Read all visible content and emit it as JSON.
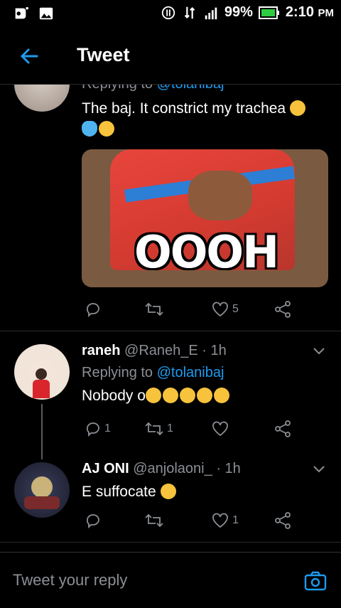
{
  "status_bar": {
    "battery": "99%",
    "time": "2:10",
    "ampm": "PM"
  },
  "header": {
    "title": "Tweet"
  },
  "tweets": [
    {
      "replying_label": "Replying to",
      "replying_handle": "@tolanibaj",
      "text": "The baj. It constrict my trachea",
      "media_text": "OOOH",
      "replies": "",
      "retweets": "",
      "likes": "5"
    },
    {
      "name": "raneh",
      "handle": "@Raneh_E",
      "time": "· 1h",
      "replying_label": "Replying to",
      "replying_handle": "@tolanibaj",
      "text": "Nobody o",
      "replies": "1",
      "retweets": "1",
      "likes": ""
    },
    {
      "name": "AJ ONI",
      "handle": "@anjolaoni_",
      "time": "· 1h",
      "text": "E suffocate",
      "replies": "",
      "retweets": "",
      "likes": "1"
    }
  ],
  "reply_bar": {
    "placeholder": "Tweet your reply"
  }
}
